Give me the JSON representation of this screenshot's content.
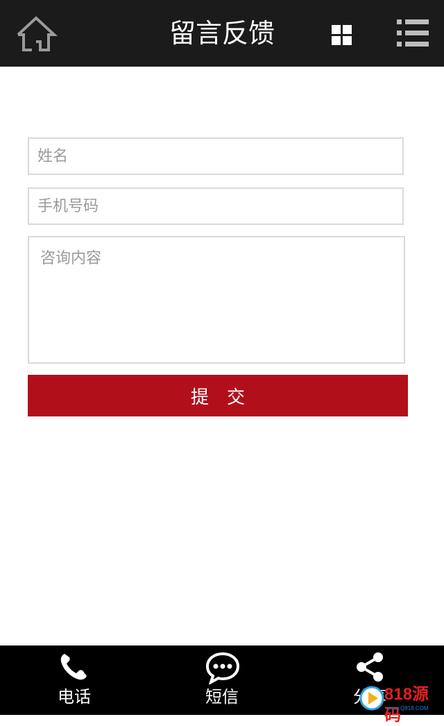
{
  "header": {
    "title": "留言反馈"
  },
  "form": {
    "name_placeholder": "姓名",
    "phone_placeholder": "手机号码",
    "content_placeholder": "咨询内容",
    "submit_label": "提交"
  },
  "footer": {
    "items": [
      {
        "label": "电话",
        "icon": "phone-icon"
      },
      {
        "label": "短信",
        "icon": "chat-bubble-icon"
      },
      {
        "label": "分享",
        "icon": "share-icon"
      }
    ]
  },
  "watermark": {
    "text": "818源码",
    "sub": "www.Q818.COM"
  },
  "colors": {
    "header_bg": "#1b1b1b",
    "submit_bg": "#b1101b",
    "footer_bg": "#000000"
  }
}
